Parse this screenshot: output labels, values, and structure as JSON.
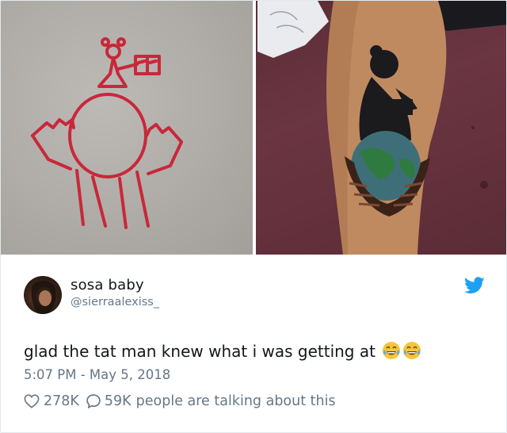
{
  "user": {
    "display_name": "sosa baby",
    "handle": "@sierraalexiss_",
    "avatar_icon": "profile-photo"
  },
  "tweet": {
    "text": "glad the tat man knew what i was getting at",
    "emoji": [
      "face-with-tears-of-joy",
      "face-with-tears-of-joy"
    ],
    "timestamp": "5:07 PM - May 5, 2018"
  },
  "actions": {
    "likes": "278K",
    "replies": "59K",
    "talking_text": "people are talking about this"
  },
  "icons": {
    "brand": "twitter-bird-icon",
    "like": "heart-icon",
    "reply": "speech-bubble-icon"
  },
  "colors": {
    "brand": "#1da1f2",
    "secondary_text": "#657786",
    "primary_text": "#14171a",
    "drawing_ink": "#c8283a",
    "emoji_yellow": "#f7c53a"
  }
}
